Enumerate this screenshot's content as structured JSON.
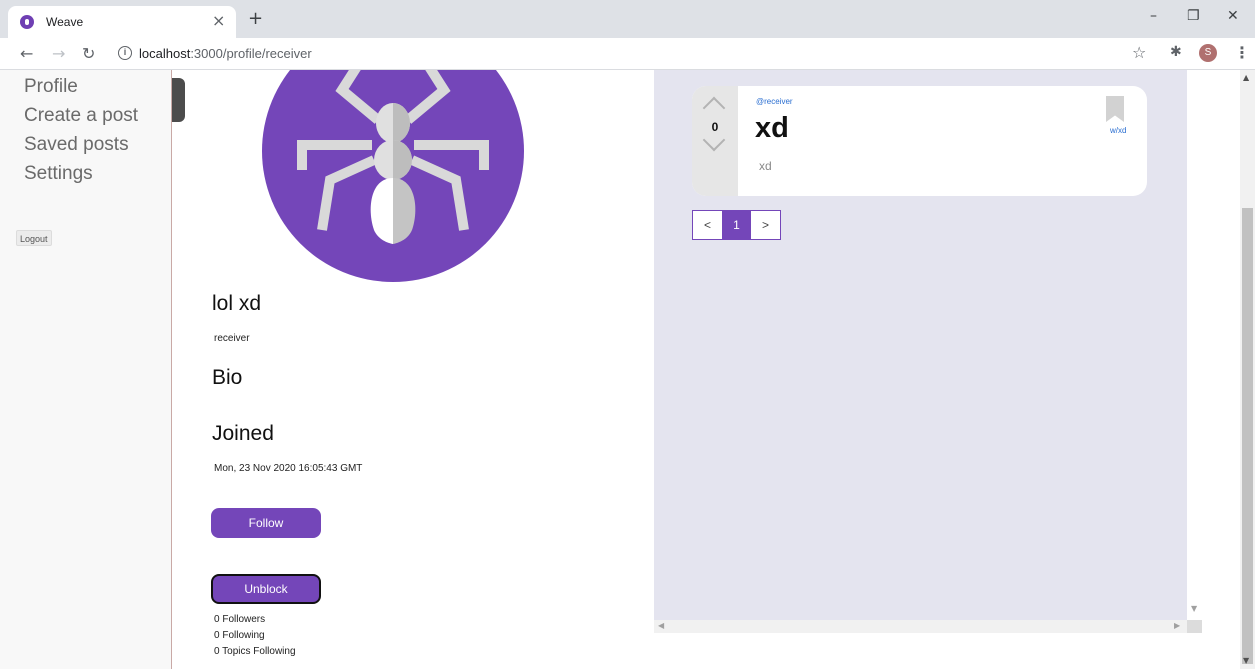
{
  "browser": {
    "tab_title": "Weave",
    "tab_close": "×",
    "new_tab": "+",
    "url_host": "localhost",
    "url_path": ":3000/profile/receiver",
    "profile_initial": "S",
    "icons": {
      "back": "arrow-left-icon",
      "forward": "arrow-right-icon",
      "reload": "reload-icon",
      "info": "info-icon",
      "star": "star-icon",
      "extensions": "puzzle-icon",
      "menu": "kebab-menu-icon"
    }
  },
  "sidebar": {
    "links": [
      "Profile",
      "Create a post",
      "Saved posts",
      "Settings"
    ],
    "logout_label": "Logout"
  },
  "profile": {
    "display_name": "lol xd",
    "username": "receiver",
    "bio_heading": "Bio",
    "joined_heading": "Joined",
    "joined_date": "Mon, 23 Nov 2020 16:05:43 GMT",
    "follow_label": "Follow",
    "unblock_label": "Unblock",
    "followers": "0 Followers",
    "following": "0 Following",
    "topics_following": "0 Topics Following",
    "avatar_color": "#7446b9"
  },
  "feed": {
    "posts": [
      {
        "author": "@receiver",
        "votes": "0",
        "title": "xd",
        "body": "xd",
        "topic": "w/xd"
      }
    ],
    "pagination": {
      "prev": "<",
      "current": "1",
      "next": ">"
    }
  },
  "colors": {
    "accent": "#7446b9",
    "feed_bg": "#e4e4ef",
    "link": "#2a6ed1"
  }
}
